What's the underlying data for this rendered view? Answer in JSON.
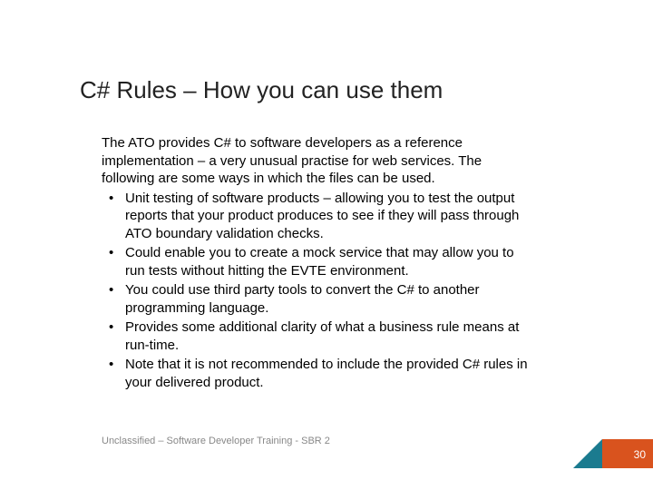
{
  "title": "C# Rules – How you can use them",
  "intro": "The ATO provides C# to software developers as a reference implementation – a very unusual practise for web services.  The following are some ways in which the files can be used.",
  "bullets": [
    "Unit testing of software products – allowing you to test the output reports that your product produces to see if they will pass through ATO boundary validation checks.",
    "Could enable you to create a mock service that may allow you to run tests without hitting the EVTE environment.",
    "You could use third party tools to convert the C# to another programming language.",
    "Provides some additional clarity of what a business rule means at run-time.",
    "Note that it is not recommended to include the provided C# rules in your delivered product."
  ],
  "footer": "Unclassified – Software Developer Training - SBR 2",
  "page_number": "30"
}
